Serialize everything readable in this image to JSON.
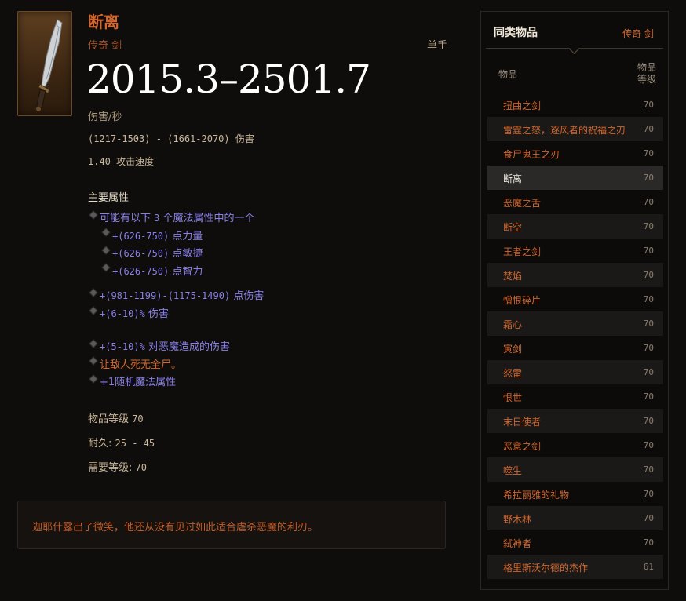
{
  "item": {
    "name": "断离",
    "type": "传奇 剑",
    "slot": "单手",
    "dps": "2015.3–2501.7",
    "dps_label": "伤害/秒",
    "damage_range": "(1217-1503) - (1661-2070)",
    "damage_label": "伤害",
    "attack_speed": "1.40",
    "attack_speed_label": "攻击速度",
    "primary_title": "主要属性",
    "affixes": {
      "random_header_a": "可能有以下",
      "random_header_num": "3",
      "random_header_b": "个魔法属性中的一个",
      "opt1_val": "+(626-750)",
      "opt1_txt": "点力量",
      "opt2_val": "+(626-750)",
      "opt2_txt": "点敏捷",
      "opt3_val": "+(626-750)",
      "opt3_txt": "点智力",
      "dmg_val": "+(981-1199)-(1175-1490)",
      "dmg_txt": "点伤害",
      "pct_val": "+(6-10)%",
      "pct_txt": "伤害",
      "demon_val": "+(5-10)%",
      "demon_txt": "对恶魔造成的伤害",
      "legendary_effect": "让敌人死无全尸。",
      "random_prop": "+1随机魔法属性"
    },
    "item_level_label": "物品等级",
    "item_level": "70",
    "durability_label": "耐久:",
    "durability": "25 - 45",
    "required_level_label": "需要等级:",
    "required_level": "70",
    "flavor": "迦耶什露出了微笑，他还从没有见过如此适合虐杀恶魔的利刃。"
  },
  "sidebar": {
    "title": "同类物品",
    "type": "传奇 剑",
    "col_item": "物品",
    "col_level_1": "物品",
    "col_level_2": "等级",
    "items": [
      {
        "name": "扭曲之剑",
        "level": "70"
      },
      {
        "name": "雷霆之怒，逐风者的祝福之刃",
        "level": "70"
      },
      {
        "name": "食尸鬼王之刃",
        "level": "70"
      },
      {
        "name": "断离",
        "level": "70"
      },
      {
        "name": "恶魔之舌",
        "level": "70"
      },
      {
        "name": "断空",
        "level": "70"
      },
      {
        "name": "王者之剑",
        "level": "70"
      },
      {
        "name": "焚焰",
        "level": "70"
      },
      {
        "name": "憎恨碎片",
        "level": "70"
      },
      {
        "name": "霜心",
        "level": "70"
      },
      {
        "name": "寅剑",
        "level": "70"
      },
      {
        "name": "怒雷",
        "level": "70"
      },
      {
        "name": "恨世",
        "level": "70"
      },
      {
        "name": "末日使者",
        "level": "70"
      },
      {
        "name": "恶意之剑",
        "level": "70"
      },
      {
        "name": "噬生",
        "level": "70"
      },
      {
        "name": "希拉丽雅的礼物",
        "level": "70"
      },
      {
        "name": "野木林",
        "level": "70"
      },
      {
        "name": "弑神者",
        "level": "70"
      },
      {
        "name": "格里斯沃尔德的杰作",
        "level": "61"
      }
    ]
  },
  "colors": {
    "legendary": "#d2672f",
    "magic": "#8880e6",
    "background": "#0f0d0b"
  },
  "icons": {
    "item": "legendary-sword-icon",
    "bullet": "diamond-bullet-icon"
  }
}
